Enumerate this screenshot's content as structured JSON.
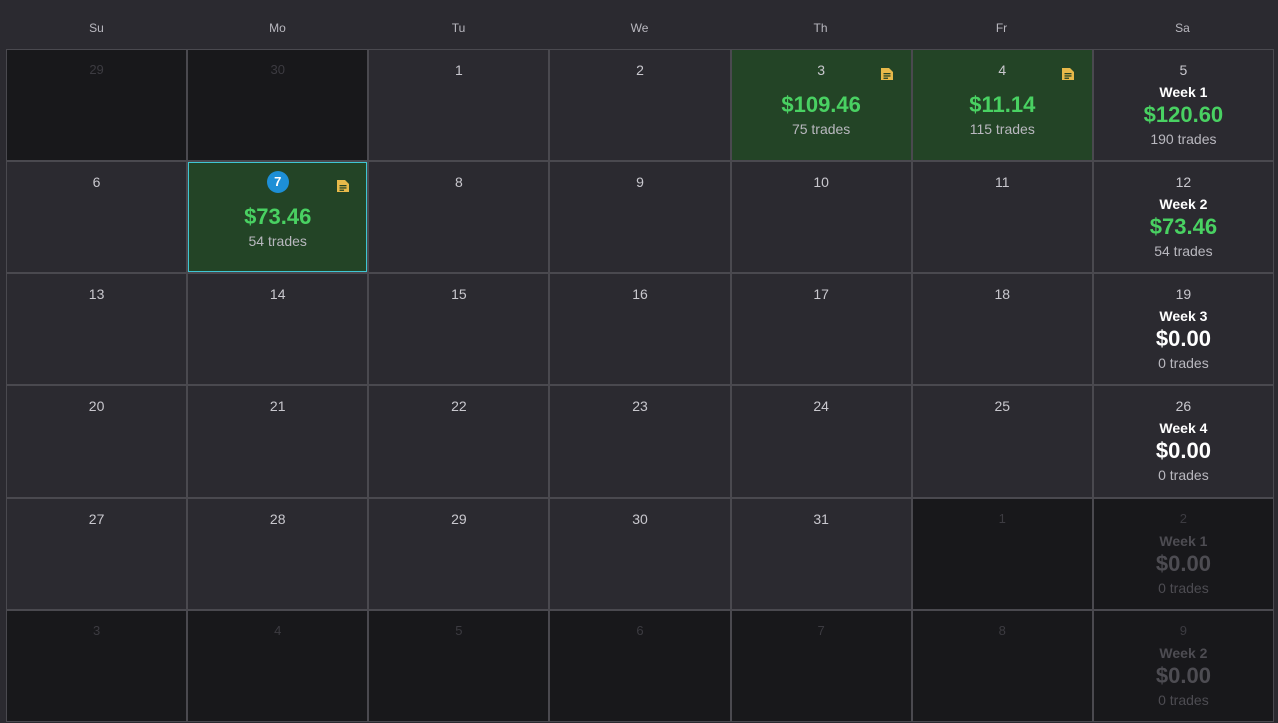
{
  "colors": {
    "background": "#2b2a30",
    "out_of_month": "#18181b",
    "profit_cell": "#234426",
    "profit_text": "#49d162",
    "today_badge": "#1d8fd6",
    "today_border": "#3fc6d4",
    "note_icon": "#e7b94a"
  },
  "weekdays": [
    "Su",
    "Mo",
    "Tu",
    "We",
    "Th",
    "Fr",
    "Sa"
  ],
  "weeks": [
    {
      "days": [
        {
          "num": "29",
          "out": true
        },
        {
          "num": "30",
          "out": true
        },
        {
          "num": "1"
        },
        {
          "num": "2"
        },
        {
          "num": "3",
          "pnl": "$109.46",
          "trades": "75 trades",
          "note": true,
          "profit": true
        },
        {
          "num": "4",
          "pnl": "$11.14",
          "trades": "115 trades",
          "note": true,
          "profit": true
        }
      ],
      "summary": {
        "num": "5",
        "label": "Week 1",
        "pnl": "$120.60",
        "trades": "190 trades",
        "positive": true
      }
    },
    {
      "days": [
        {
          "num": "6"
        },
        {
          "num": "7",
          "pnl": "$73.46",
          "trades": "54 trades",
          "note": true,
          "profit": true,
          "today": true
        },
        {
          "num": "8"
        },
        {
          "num": "9"
        },
        {
          "num": "10"
        },
        {
          "num": "11"
        }
      ],
      "summary": {
        "num": "12",
        "label": "Week 2",
        "pnl": "$73.46",
        "trades": "54 trades",
        "positive": true
      }
    },
    {
      "days": [
        {
          "num": "13"
        },
        {
          "num": "14"
        },
        {
          "num": "15"
        },
        {
          "num": "16"
        },
        {
          "num": "17"
        },
        {
          "num": "18"
        }
      ],
      "summary": {
        "num": "19",
        "label": "Week 3",
        "pnl": "$0.00",
        "trades": "0 trades"
      }
    },
    {
      "days": [
        {
          "num": "20"
        },
        {
          "num": "21"
        },
        {
          "num": "22"
        },
        {
          "num": "23"
        },
        {
          "num": "24"
        },
        {
          "num": "25"
        }
      ],
      "summary": {
        "num": "26",
        "label": "Week 4",
        "pnl": "$0.00",
        "trades": "0 trades"
      }
    },
    {
      "days": [
        {
          "num": "27"
        },
        {
          "num": "28"
        },
        {
          "num": "29"
        },
        {
          "num": "30"
        },
        {
          "num": "31"
        },
        {
          "num": "1",
          "out": true
        }
      ],
      "summary": {
        "num": "2",
        "label": "Week 1",
        "pnl": "$0.00",
        "trades": "0 trades",
        "out": true
      }
    },
    {
      "days": [
        {
          "num": "3",
          "out": true
        },
        {
          "num": "4",
          "out": true
        },
        {
          "num": "5",
          "out": true
        },
        {
          "num": "6",
          "out": true
        },
        {
          "num": "7",
          "out": true
        },
        {
          "num": "8",
          "out": true
        }
      ],
      "summary": {
        "num": "9",
        "label": "Week 2",
        "pnl": "$0.00",
        "trades": "0 trades",
        "out": true
      }
    }
  ]
}
